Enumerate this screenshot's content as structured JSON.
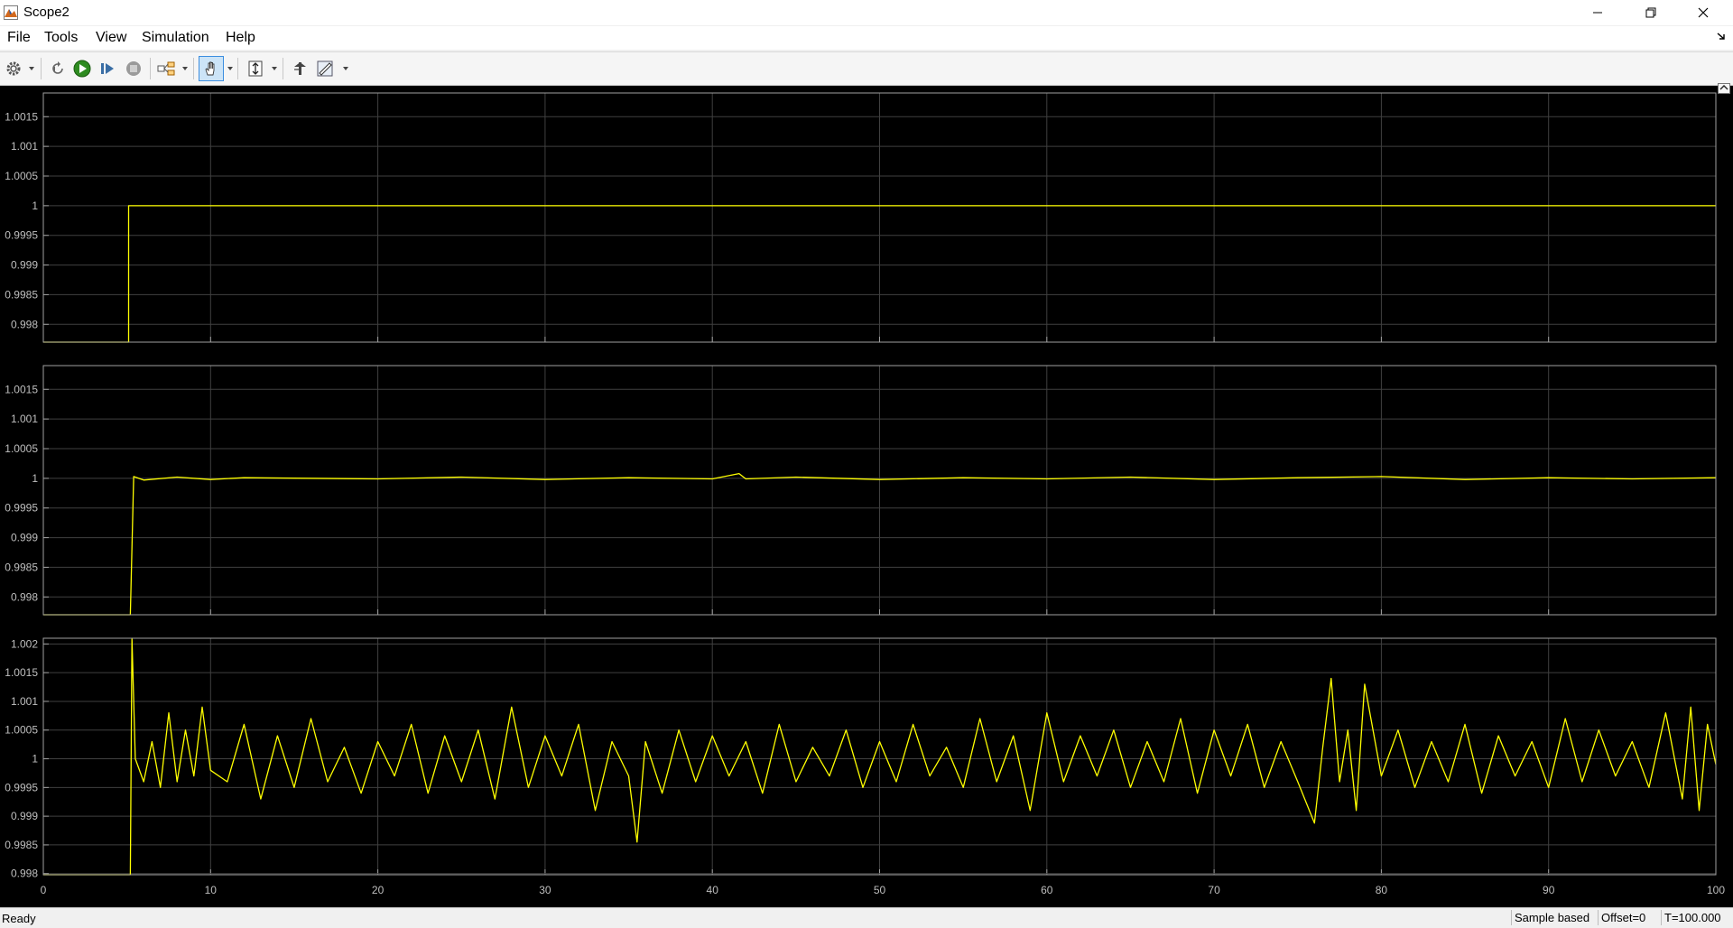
{
  "window": {
    "title": "Scope2"
  },
  "menu": {
    "items": [
      "File",
      "Tools",
      "View",
      "Simulation",
      "Help"
    ]
  },
  "status": {
    "ready": "Ready",
    "sample": "Sample based",
    "offset": "Offset=0",
    "time": "T=100.000"
  },
  "colors": {
    "trace": "#ffff00",
    "axes_bg": "#000000",
    "figure_bg": "#000000",
    "grid": "#404040",
    "axes_border": "#a0a0a0",
    "tick_text": "#bfbfbf"
  },
  "icons": [
    "app-icon",
    "minimize-icon",
    "restore-icon",
    "close-icon",
    "dock-arrow-icon",
    "settings-gear-icon",
    "step-back-icon",
    "run-icon",
    "step-forward-icon",
    "stop-icon",
    "highlight-block-icon",
    "pan-hand-icon",
    "zoom-axes-icon",
    "restore-view-icon",
    "measurement-icon",
    "expand-icon"
  ],
  "chart_data": [
    {
      "type": "line",
      "title": "",
      "xlabel": "",
      "ylabel": "",
      "xlim": [
        0,
        100
      ],
      "ylim": [
        0.9977,
        1.0019
      ],
      "xticks": [
        0,
        10,
        20,
        30,
        40,
        50,
        60,
        70,
        80,
        90,
        100
      ],
      "yticks": [
        "0.998",
        "0.9985",
        "0.999",
        "0.9995",
        "1",
        "1.0005",
        "1.001",
        "1.0015"
      ],
      "show_xtick_labels": false,
      "grid": true,
      "legend": "none",
      "series": [
        {
          "x": [
            0,
            5.1,
            5.1,
            100
          ],
          "y": [
            0.9977,
            0.9977,
            1.0,
            1.0
          ]
        }
      ]
    },
    {
      "type": "line",
      "title": "",
      "xlabel": "",
      "ylabel": "",
      "xlim": [
        0,
        100
      ],
      "ylim": [
        0.9977,
        1.0019
      ],
      "xticks": [
        0,
        10,
        20,
        30,
        40,
        50,
        60,
        70,
        80,
        90,
        100
      ],
      "yticks": [
        "0.998",
        "0.9985",
        "0.999",
        "0.9995",
        "1",
        "1.0005",
        "1.001",
        "1.0015"
      ],
      "show_xtick_labels": false,
      "grid": true,
      "legend": "none",
      "series": [
        {
          "x": [
            0,
            5.2,
            5.4,
            6,
            8,
            10,
            12,
            20,
            25,
            30,
            35,
            40,
            41.6,
            42,
            45,
            50,
            55,
            60,
            65,
            70,
            75,
            80,
            85,
            90,
            95,
            100
          ],
          "y": [
            0.9977,
            0.9977,
            1.00003,
            0.99997,
            1.00002,
            0.99998,
            1.00001,
            0.99999,
            1.00002,
            0.99998,
            1.00001,
            0.99999,
            1.00008,
            0.99999,
            1.00002,
            0.99998,
            1.00001,
            0.99999,
            1.00002,
            0.99998,
            1.00001,
            1.00003,
            0.99998,
            1.00001,
            0.99999,
            1.00001
          ]
        }
      ]
    },
    {
      "type": "line",
      "title": "",
      "xlabel": "",
      "ylabel": "",
      "xlim": [
        0,
        100
      ],
      "ylim": [
        0.99798,
        1.0021
      ],
      "xticks": [
        0,
        10,
        20,
        30,
        40,
        50,
        60,
        70,
        80,
        90,
        100
      ],
      "xtick_labels": [
        "0",
        "10",
        "20",
        "30",
        "40",
        "50",
        "60",
        "70",
        "80",
        "90",
        "100"
      ],
      "yticks": [
        "0.998",
        "0.9985",
        "0.999",
        "0.9995",
        "1",
        "1.0005",
        "1.001",
        "1.0015",
        "1.002"
      ],
      "show_xtick_labels": true,
      "grid": true,
      "legend": "none",
      "series": [
        {
          "x": [
            0,
            5.2,
            5.3,
            5.5,
            6,
            6.5,
            7,
            7.5,
            8,
            8.5,
            9,
            9.5,
            10,
            11,
            12,
            13,
            14,
            15,
            16,
            17,
            18,
            19,
            20,
            21,
            22,
            23,
            24,
            25,
            26,
            27,
            28,
            29,
            30,
            31,
            32,
            33,
            34,
            35,
            35.5,
            36,
            37,
            38,
            39,
            40,
            41,
            42,
            43,
            44,
            45,
            46,
            47,
            48,
            49,
            50,
            51,
            52,
            53,
            54,
            55,
            56,
            57,
            58,
            59,
            60,
            61,
            62,
            63,
            64,
            65,
            66,
            67,
            68,
            69,
            70,
            71,
            72,
            73,
            74,
            75,
            76,
            76.5,
            77,
            77.5,
            78,
            78.5,
            79,
            80,
            81,
            82,
            83,
            84,
            85,
            86,
            87,
            88,
            89,
            90,
            91,
            92,
            93,
            94,
            95,
            96,
            97,
            98,
            98.5,
            99,
            99.5,
            100
          ],
          "y": [
            0.99798,
            0.99798,
            1.0021,
            1.0,
            0.9996,
            1.0003,
            0.9995,
            1.0008,
            0.9996,
            1.0005,
            0.9997,
            1.0009,
            0.9998,
            0.9996,
            1.0006,
            0.9993,
            1.0004,
            0.9995,
            1.0007,
            0.9996,
            1.0002,
            0.9994,
            1.0003,
            0.9997,
            1.0006,
            0.9994,
            1.0004,
            0.9996,
            1.0005,
            0.9993,
            1.0009,
            0.9995,
            1.0004,
            0.9997,
            1.0006,
            0.9991,
            1.0003,
            0.9997,
            0.99855,
            1.0003,
            0.9994,
            1.0005,
            0.9996,
            1.0004,
            0.9997,
            1.0003,
            0.9994,
            1.0006,
            0.9996,
            1.0002,
            0.9997,
            1.0005,
            0.9995,
            1.0003,
            0.9996,
            1.0006,
            0.9997,
            1.0002,
            0.9995,
            1.0007,
            0.9996,
            1.0004,
            0.9991,
            1.0008,
            0.9996,
            1.0004,
            0.9997,
            1.0005,
            0.9995,
            1.0003,
            0.9996,
            1.0007,
            0.9994,
            1.0005,
            0.9997,
            1.0006,
            0.9995,
            1.0003,
            0.9996,
            0.99888,
            1.0002,
            1.0014,
            0.9996,
            1.0005,
            0.9991,
            1.0013,
            0.9997,
            1.0005,
            0.9995,
            1.0003,
            0.9996,
            1.0006,
            0.9994,
            1.0004,
            0.9997,
            1.0003,
            0.9995,
            1.0007,
            0.9996,
            1.0005,
            0.9997,
            1.0003,
            0.9995,
            1.0008,
            0.9993,
            1.0009,
            0.9991,
            1.0006,
            0.9999
          ]
        }
      ]
    }
  ]
}
